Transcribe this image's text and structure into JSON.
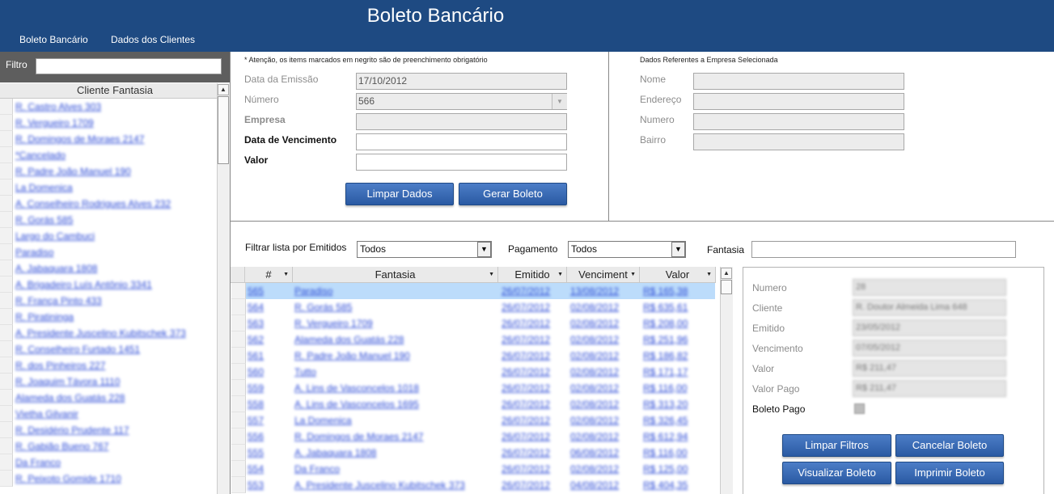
{
  "app": {
    "title": "Boleto Bancário"
  },
  "menu": {
    "items": [
      "Boleto Bancário",
      "Dados dos Clientes"
    ]
  },
  "sidebar": {
    "filter_label": "Filtro",
    "filter_value": "",
    "column_header": "Cliente Fantasia",
    "clients": [
      "R. Castro Alves 303",
      "R. Vergueiro 1709",
      "R. Domingos de Moraes 2147",
      "*Cancelado",
      "R. Padre João Manuel 190",
      "La Domenica",
      "A. Conselheiro Rodrigues Alves 232",
      "R. Gorás 585",
      "Largo do Cambuci",
      "Paradiso",
      "A. Jabaquara 1808",
      "A. Brigadeiro Luís Antônio 3341",
      "R. França Pinto 433",
      "R. Piratininga",
      "A. Presidente Juscelino Kubitschek 373",
      "R. Conselheiro Furtado 1451",
      "R. dos Pinheiros 227",
      "R. Joaquim Távora 1110",
      "Alameda dos Guatás 228",
      "Vietha Gilvanir",
      "R. Desidério Prudente 117",
      "R. Gabião Bueno 767",
      "Da Franco",
      "R. Peixoto Gomide 1710"
    ]
  },
  "form": {
    "note": "* Atenção, os items marcados em negrito são de preenchimento obrigatório",
    "fields": {
      "data_emissao": {
        "label": "Data da Emissão",
        "value": "17/10/2012"
      },
      "numero": {
        "label": "Número",
        "value": "566"
      },
      "empresa": {
        "label": "Empresa",
        "value": ""
      },
      "data_vencimento": {
        "label": "Data de Vencimento",
        "value": ""
      },
      "valor": {
        "label": "Valor",
        "value": ""
      }
    },
    "buttons": {
      "limpar": "Limpar Dados",
      "gerar": "Gerar Boleto"
    }
  },
  "empresa": {
    "title": "Dados Referentes a Empresa Selecionada",
    "fields": {
      "nome": {
        "label": "Nome",
        "value": ""
      },
      "endereco": {
        "label": "Endereço",
        "value": ""
      },
      "numero": {
        "label": "Numero",
        "value": ""
      },
      "bairro": {
        "label": "Bairro",
        "value": ""
      }
    }
  },
  "filters": {
    "emitidos_label": "Filtrar lista por Emitidos",
    "emitidos_value": "Todos",
    "pagamento_label": "Pagamento",
    "pagamento_value": "Todos",
    "fantasia_label": "Fantasia",
    "fantasia_value": ""
  },
  "grid": {
    "columns": [
      "#",
      "Fantasia",
      "Emitido",
      "Venciment",
      "Valor"
    ],
    "rows": [
      [
        "565",
        "Paradiso",
        "26/07/2012",
        "13/08/2012",
        "R$ 165,38"
      ],
      [
        "564",
        "R. Gorás 585",
        "26/07/2012",
        "02/08/2012",
        "R$ 635,61"
      ],
      [
        "563",
        "R. Vergueiro 1709",
        "26/07/2012",
        "02/08/2012",
        "R$ 208,00"
      ],
      [
        "562",
        "Alameda dos Guatás 228",
        "26/07/2012",
        "02/08/2012",
        "R$ 251,96"
      ],
      [
        "561",
        "R. Padre João Manuel 190",
        "26/07/2012",
        "02/08/2012",
        "R$ 186,82"
      ],
      [
        "560",
        "Tutto",
        "26/07/2012",
        "02/08/2012",
        "R$ 171,17"
      ],
      [
        "559",
        "A. Lins de Vasconcelos 1018",
        "26/07/2012",
        "02/08/2012",
        "R$ 116,00"
      ],
      [
        "558",
        "A. Lins de Vasconcelos 1695",
        "26/07/2012",
        "02/08/2012",
        "R$ 313,20"
      ],
      [
        "557",
        "La Domenica",
        "26/07/2012",
        "02/08/2012",
        "R$ 326,45"
      ],
      [
        "556",
        "R. Domingos de Moraes 2147",
        "26/07/2012",
        "02/08/2012",
        "R$ 612,94"
      ],
      [
        "555",
        "A. Jabaquara 1808",
        "26/07/2012",
        "06/08/2012",
        "R$ 116,00"
      ],
      [
        "554",
        "Da Franco",
        "26/07/2012",
        "02/08/2012",
        "R$ 125,00"
      ],
      [
        "553",
        "A. Presidente Juscelino Kubitschek 373",
        "26/07/2012",
        "04/08/2012",
        "R$ 404,35"
      ]
    ]
  },
  "detail": {
    "fields": [
      {
        "label": "Numero",
        "value": "28"
      },
      {
        "label": "Cliente",
        "value": "R. Doutor Almeida Lima 648"
      },
      {
        "label": "Emitido",
        "value": "23/05/2012"
      },
      {
        "label": "Vencimento",
        "value": "07/05/2012"
      },
      {
        "label": "Valor",
        "value": "R$ 211,47"
      },
      {
        "label": "Valor Pago",
        "value": "R$ 211,47"
      }
    ],
    "boleto_pago_label": "Boleto Pago",
    "boleto_pago": true,
    "buttons": {
      "limpar_filtros": "Limpar Filtros",
      "cancelar": "Cancelar Boleto",
      "visualizar": "Visualizar Boleto",
      "imprimir": "Imprimir Boleto"
    }
  }
}
